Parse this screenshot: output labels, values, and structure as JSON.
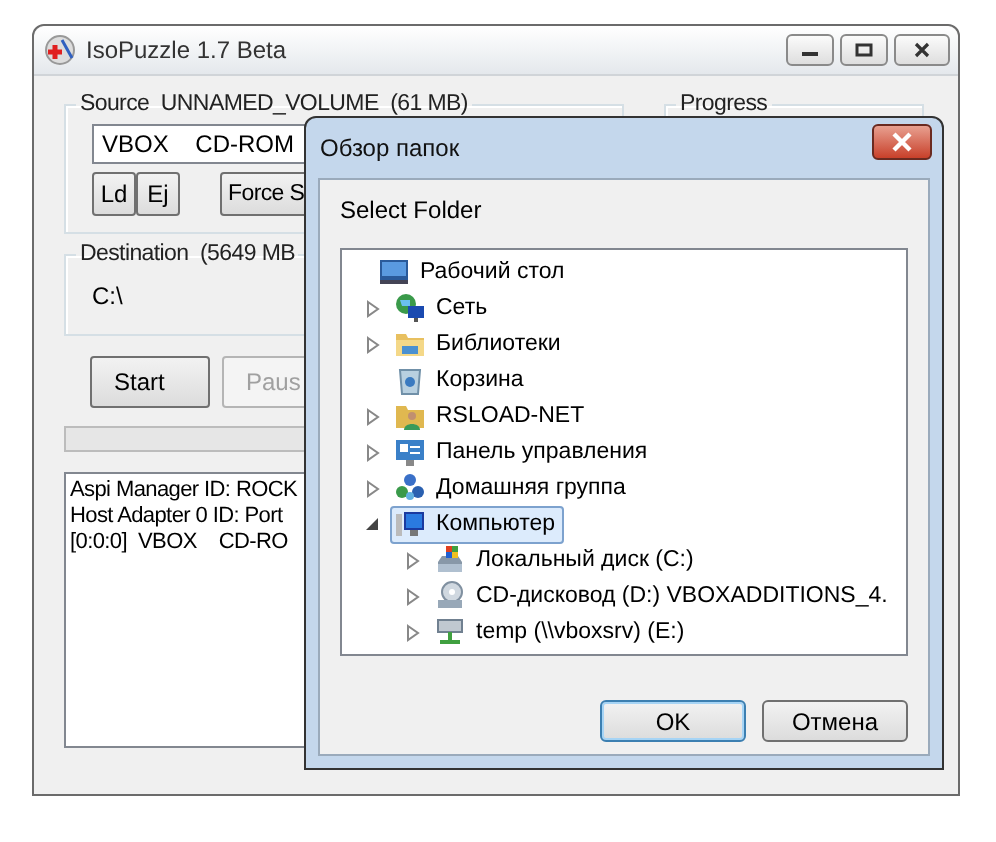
{
  "window": {
    "title": "IsoPuzzle 1.7 Beta"
  },
  "source": {
    "legend": "Source  UNNAMED_VOLUME  (61 MB)",
    "drive": "VBOX    CD-ROM",
    "buttons": [
      {
        "label": "Ld",
        "disabled": false
      },
      {
        "label": "Ej",
        "disabled": false
      },
      {
        "label": "Force S",
        "disabled": false
      }
    ]
  },
  "progress_group": {
    "legend": "Progress"
  },
  "destination": {
    "legend": "Destination  (5649 MB",
    "path": "C:\\"
  },
  "actions": [
    {
      "label": "Start",
      "disabled": false
    },
    {
      "label": "Paus",
      "disabled": true
    }
  ],
  "progress_bar": {
    "level": 0
  },
  "log": [
    "Aspi Manager ID: ROCK",
    "Host Adapter 0 ID: Port",
    "[0:0:0]  VBOX    CD-RO"
  ],
  "dialog": {
    "title": "Обзор папок",
    "prompt": "Select Folder",
    "tree": [
      {
        "label": "Рабочий стол",
        "selected": false,
        "children": [
          {
            "label": "Сеть",
            "expanded": false,
            "selected": false
          },
          {
            "label": "Библиотеки",
            "expanded": false,
            "selected": false
          },
          {
            "label": "Корзина",
            "selected": false
          },
          {
            "label": "RSLOAD-NET",
            "expanded": false,
            "selected": false
          },
          {
            "label": "Панель управления",
            "expanded": false,
            "selected": false
          },
          {
            "label": "Домашняя группа",
            "expanded": false,
            "selected": false
          },
          {
            "label": "Компьютер",
            "expanded": true,
            "selected": true,
            "children": [
              {
                "label": "Локальный диск (C:)",
                "expanded": false,
                "selected": false
              },
              {
                "label": "CD-дисковод (D:) VBOXADDITIONS_4.",
                "expanded": false,
                "selected": false
              },
              {
                "label": "temp (\\\\vboxsrv) (E:)",
                "expanded": false,
                "selected": false
              }
            ]
          }
        ]
      }
    ],
    "buttons": [
      {
        "label": "OK",
        "default": true
      },
      {
        "label": "Отмена",
        "default": false
      }
    ]
  }
}
